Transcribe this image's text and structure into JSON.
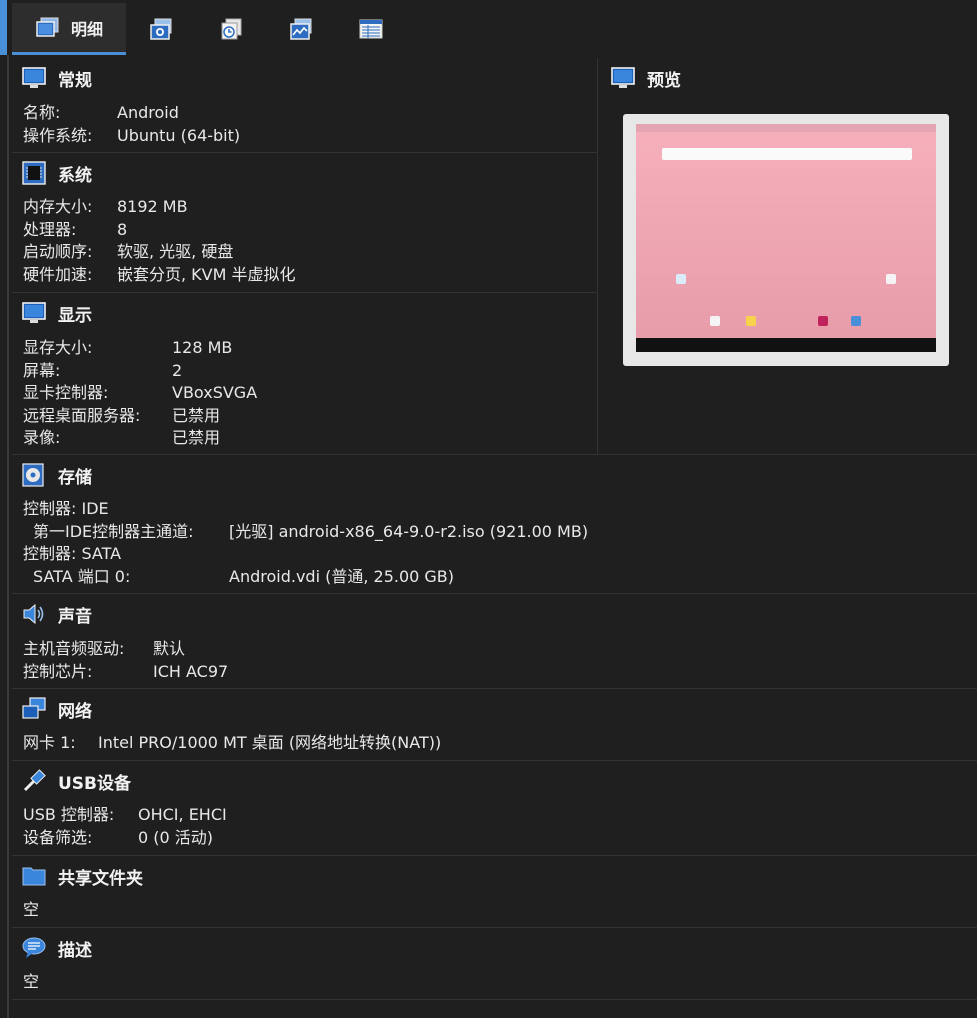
{
  "tabs": [
    {
      "label": "明细",
      "icon": "details-monitor-icon"
    },
    {
      "icon": "snapshot-camera-icon"
    },
    {
      "icon": "logs-clock-icon"
    },
    {
      "icon": "activity-chart-icon"
    },
    {
      "icon": "table-list-icon"
    }
  ],
  "general": {
    "title": "常规",
    "rows": [
      {
        "k": "名称:",
        "v": "Android"
      },
      {
        "k": "操作系统:",
        "v": "Ubuntu (64-bit)"
      }
    ]
  },
  "system": {
    "title": "系统",
    "rows": [
      {
        "k": "内存大小:",
        "v": "8192 MB"
      },
      {
        "k": "处理器:",
        "v": "8"
      },
      {
        "k": "启动顺序:",
        "v": "软驱, 光驱, 硬盘"
      },
      {
        "k": "硬件加速:",
        "v": "嵌套分页, KVM 半虚拟化"
      }
    ]
  },
  "display": {
    "title": "显示",
    "rows": [
      {
        "k": "显存大小:",
        "v": "128 MB"
      },
      {
        "k": "屏幕:",
        "v": "2"
      },
      {
        "k": "显卡控制器:",
        "v": "VBoxSVGA"
      },
      {
        "k": "远程桌面服务器:",
        "v": "已禁用"
      },
      {
        "k": "录像:",
        "v": "已禁用"
      }
    ]
  },
  "preview": {
    "title": "预览"
  },
  "storage": {
    "title": "存储",
    "rows": [
      {
        "k": "控制器: IDE",
        "v": ""
      },
      {
        "k": "第一IDE控制器主通道:",
        "v": "[光驱] android-x86_64-9.0-r2.iso (921.00 MB)"
      },
      {
        "k": "控制器: SATA",
        "v": ""
      },
      {
        "k": "SATA 端口 0:",
        "v": "Android.vdi (普通, 25.00 GB)"
      }
    ]
  },
  "audio": {
    "title": "声音",
    "rows": [
      {
        "k": "主机音频驱动:",
        "v": "默认"
      },
      {
        "k": "控制芯片:",
        "v": "ICH AC97"
      }
    ]
  },
  "network": {
    "title": "网络",
    "rows": [
      {
        "k": "网卡 1:",
        "v": "Intel PRO/1000 MT 桌面 (网络地址转换(NAT))"
      }
    ]
  },
  "usb": {
    "title": "USB设备",
    "rows": [
      {
        "k": "USB 控制器:",
        "v": "OHCI, EHCI"
      },
      {
        "k": "设备筛选:",
        "v": "0 (0 活动)"
      }
    ]
  },
  "shared": {
    "title": "共享文件夹",
    "rows": [
      {
        "k": "空",
        "v": ""
      }
    ]
  },
  "description": {
    "title": "描述",
    "rows": [
      {
        "k": "空",
        "v": ""
      }
    ]
  },
  "colors": {
    "accent": "#4a90d9",
    "background": "#1f1f1f",
    "text": "#e8e8e8"
  }
}
